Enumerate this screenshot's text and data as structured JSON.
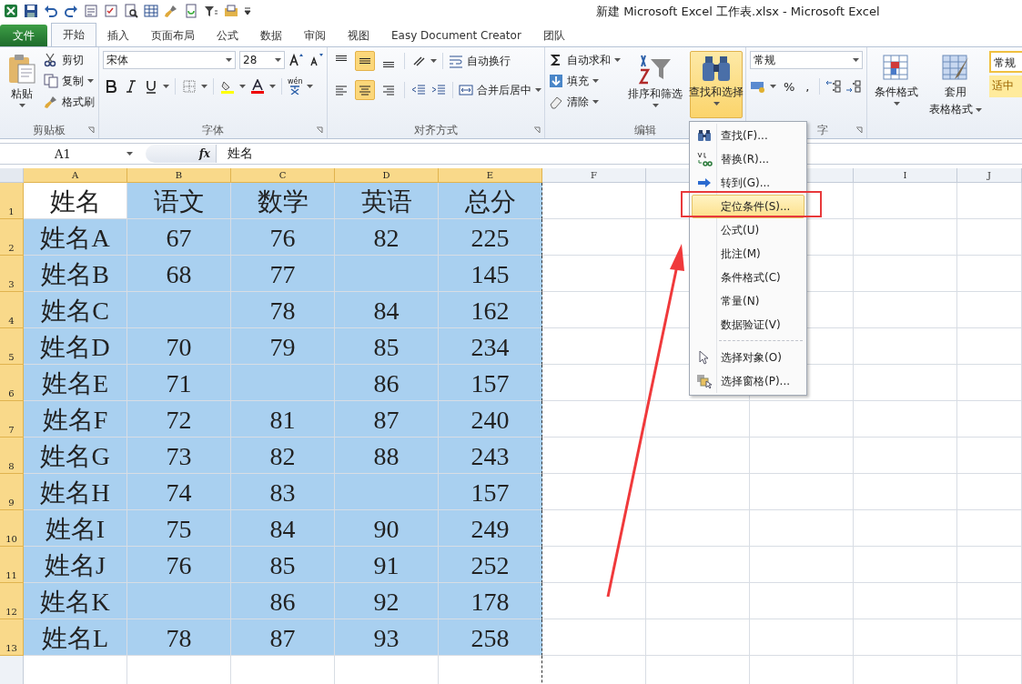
{
  "window": {
    "title": "新建 Microsoft Excel 工作表.xlsx  -  Microsoft Excel"
  },
  "tabs": [
    {
      "label": "文件",
      "kind": "file",
      "selected": false
    },
    {
      "label": "开始",
      "kind": "tab",
      "selected": true
    },
    {
      "label": "插入",
      "kind": "tab",
      "selected": false
    },
    {
      "label": "页面布局",
      "kind": "tab",
      "selected": false
    },
    {
      "label": "公式",
      "kind": "tab",
      "selected": false
    },
    {
      "label": "数据",
      "kind": "tab",
      "selected": false
    },
    {
      "label": "审阅",
      "kind": "tab",
      "selected": false
    },
    {
      "label": "视图",
      "kind": "tab",
      "selected": false
    },
    {
      "label": "Easy Document Creator",
      "kind": "tab",
      "selected": false
    },
    {
      "label": "团队",
      "kind": "tab",
      "selected": false
    }
  ],
  "ribbon": {
    "clipboard": {
      "label": "剪贴板",
      "paste": "粘贴",
      "cut": "剪切",
      "copy": "复制",
      "format_painter": "格式刷"
    },
    "font": {
      "label": "字体",
      "font_name": "宋体",
      "font_size": "28",
      "phonetic": "wén"
    },
    "alignment": {
      "label": "对齐方式",
      "wrap_text": "自动换行",
      "merge_center": "合并后居中",
      "vertical": [
        {
          "kind": "top",
          "selected": false
        },
        {
          "kind": "middle",
          "selected": true
        },
        {
          "kind": "bottom",
          "selected": false
        }
      ],
      "horizontal": [
        {
          "kind": "left",
          "selected": false
        },
        {
          "kind": "center",
          "selected": true
        },
        {
          "kind": "right",
          "selected": false
        }
      ]
    },
    "editing": {
      "label": "编辑",
      "autosum": "自动求和",
      "fill": "填充",
      "clear": "清除",
      "sort_filter": "排序和筛选",
      "find_select": "查找和选择",
      "find_select_open": true
    },
    "number": {
      "label": "字",
      "format": "常规",
      "percent": "%",
      "comma": ","
    },
    "styles": {
      "conditional_format": "条件格式",
      "table_format_1": "套用",
      "table_format_2": "表格格式",
      "style_normal": "常规",
      "style_neutral": "适中"
    }
  },
  "formula_bar": {
    "name_box": "A1",
    "fx": "fx",
    "value": "姓名"
  },
  "sheet": {
    "columns": [
      {
        "label": "A",
        "selected": true
      },
      {
        "label": "B",
        "selected": true
      },
      {
        "label": "C",
        "selected": true
      },
      {
        "label": "D",
        "selected": true
      },
      {
        "label": "E",
        "selected": true
      },
      {
        "label": "F",
        "selected": false
      },
      {
        "selected": false
      },
      {
        "selected": false
      },
      {
        "label": "I",
        "selected": false
      },
      {
        "label": "J",
        "selected": false
      }
    ],
    "rows": [
      {
        "number": "1",
        "selected": true,
        "cells": [
          {
            "text": "姓名",
            "active": true
          },
          "语文",
          "数学",
          "英语",
          "总分"
        ]
      },
      {
        "number": "2",
        "selected": true,
        "cells": [
          "姓名A",
          "67",
          "76",
          "82",
          "225"
        ]
      },
      {
        "number": "3",
        "selected": true,
        "cells": [
          "姓名B",
          "68",
          "77",
          null,
          "145"
        ]
      },
      {
        "number": "4",
        "selected": true,
        "cells": [
          "姓名C",
          null,
          "78",
          "84",
          "162"
        ]
      },
      {
        "number": "5",
        "selected": true,
        "cells": [
          "姓名D",
          "70",
          "79",
          "85",
          "234"
        ]
      },
      {
        "number": "6",
        "selected": true,
        "cells": [
          "姓名E",
          "71",
          null,
          "86",
          "157"
        ]
      },
      {
        "number": "7",
        "selected": true,
        "cells": [
          "姓名F",
          "72",
          "81",
          "87",
          "240"
        ]
      },
      {
        "number": "8",
        "selected": true,
        "cells": [
          "姓名G",
          "73",
          "82",
          "88",
          "243"
        ]
      },
      {
        "number": "9",
        "selected": true,
        "cells": [
          "姓名H",
          "74",
          "83",
          null,
          "157"
        ]
      },
      {
        "number": "10",
        "selected": true,
        "cells": [
          "姓名I",
          "75",
          "84",
          "90",
          "249"
        ]
      },
      {
        "number": "11",
        "selected": true,
        "cells": [
          "姓名J",
          "76",
          "85",
          "91",
          "252"
        ]
      },
      {
        "number": "12",
        "selected": true,
        "cells": [
          "姓名K",
          null,
          "86",
          "92",
          "178"
        ]
      },
      {
        "number": "13",
        "selected": true,
        "cells": [
          "姓名L",
          "78",
          "87",
          "93",
          "258"
        ]
      }
    ]
  },
  "menu": {
    "items": [
      {
        "label": "查找(F)...",
        "kind": "find",
        "selected": false,
        "separator_before": false
      },
      {
        "label": "替换(R)...",
        "kind": "replace",
        "selected": false,
        "separator_before": false
      },
      {
        "label": "转到(G)...",
        "kind": "goto",
        "selected": false,
        "separator_before": false
      },
      {
        "label": "定位条件(S)...",
        "kind": "plain",
        "selected": true,
        "separator_before": false
      },
      {
        "label": "公式(U)",
        "kind": "plain",
        "selected": false,
        "separator_before": false
      },
      {
        "label": "批注(M)",
        "kind": "plain",
        "selected": false,
        "separator_before": false
      },
      {
        "label": "条件格式(C)",
        "kind": "plain",
        "selected": false,
        "separator_before": false
      },
      {
        "label": "常量(N)",
        "kind": "plain",
        "selected": false,
        "separator_before": false
      },
      {
        "label": "数据验证(V)",
        "kind": "plain",
        "selected": false,
        "separator_before": false
      },
      {
        "label": "选择对象(O)",
        "kind": "select_objects",
        "selected": false,
        "separator_before": true
      },
      {
        "label": "选择窗格(P)...",
        "kind": "selection_pane",
        "selected": false,
        "separator_before": false
      }
    ]
  },
  "annotations": {
    "highlight": true,
    "arrow": true
  }
}
